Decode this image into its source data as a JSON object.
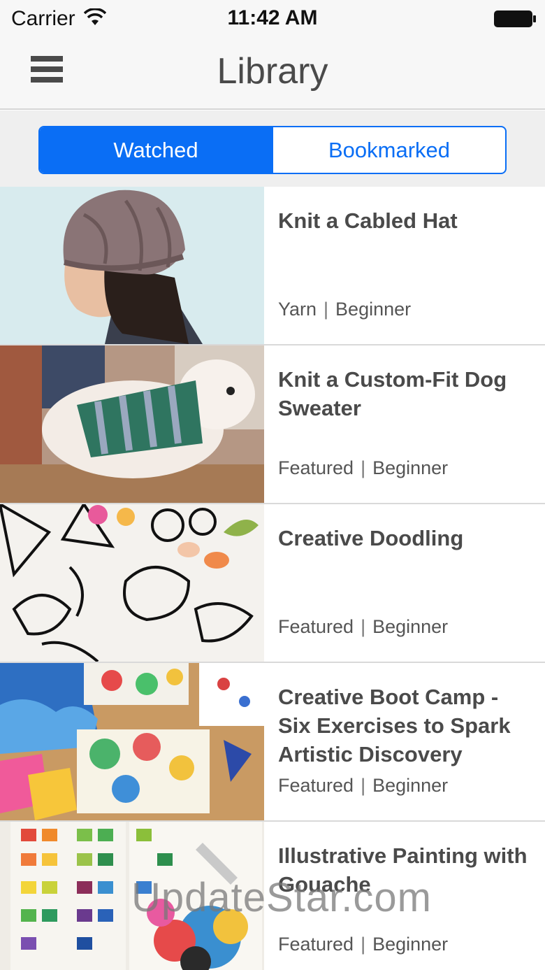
{
  "status": {
    "carrier": "Carrier",
    "time": "11:42 AM"
  },
  "nav": {
    "title": "Library"
  },
  "tabs": {
    "watched": "Watched",
    "bookmarked": "Bookmarked",
    "selected": "Watched"
  },
  "items": [
    {
      "title": "Knit a Cabled Hat",
      "category": "Yarn",
      "level": "Beginner"
    },
    {
      "title": "Knit a Custom-Fit Dog Sweater",
      "category": "Featured",
      "level": "Beginner"
    },
    {
      "title": "Creative Doodling",
      "category": "Featured",
      "level": "Beginner"
    },
    {
      "title": "Creative Boot Camp - Six Exercises to Spark Artistic Discovery",
      "category": "Featured",
      "level": "Beginner"
    },
    {
      "title": "Illustrative Painting with Gouache",
      "category": "Featured",
      "level": "Beginner"
    }
  ],
  "watermark": "UpdateStar.com",
  "colors": {
    "accent": "#0a6ef5",
    "text": "#4a4a4a",
    "background": "#f7f7f7"
  }
}
